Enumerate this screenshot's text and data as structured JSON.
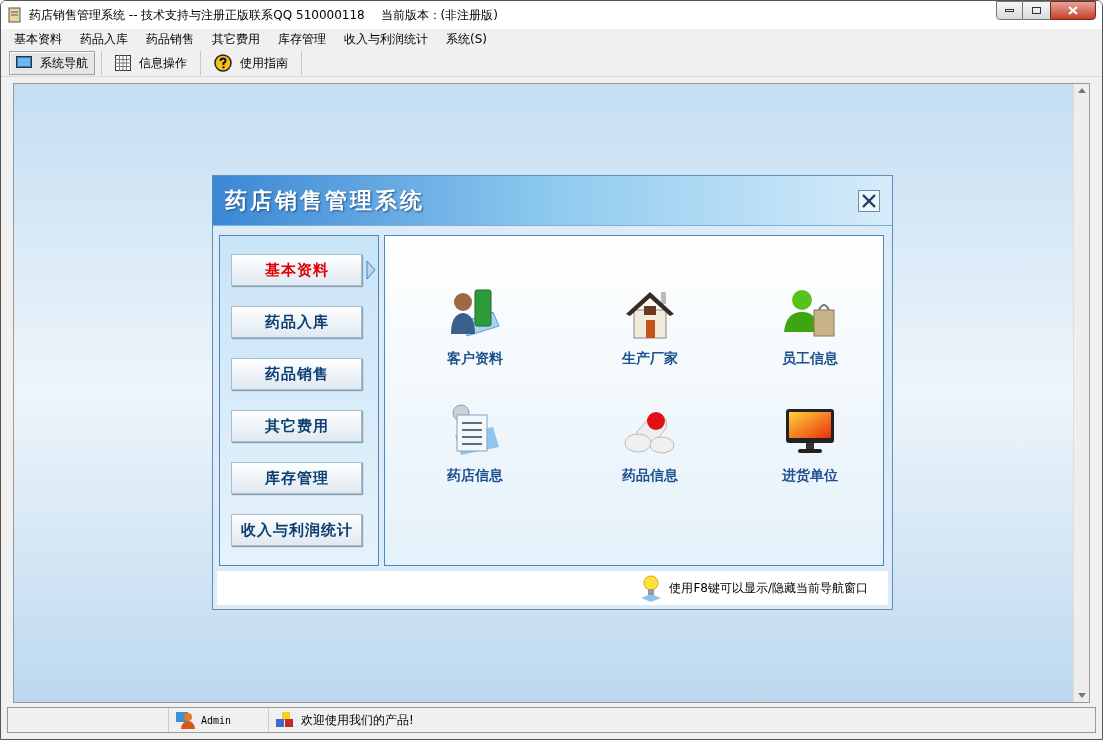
{
  "window": {
    "title": "药店销售管理系统 -- 技术支持与注册正版联系QQ 510000118　 当前版本：(非注册版)"
  },
  "menu": [
    "基本资料",
    "药品入库",
    "药品销售",
    "其它费用",
    "库存管理",
    "收入与利润统计",
    "系统(S)"
  ],
  "toolbar": [
    {
      "label": "系统导航",
      "kind": "monitor",
      "selected": true
    },
    {
      "label": "信息操作",
      "kind": "grid",
      "selected": false
    },
    {
      "label": "使用指南",
      "kind": "help",
      "selected": false
    }
  ],
  "dialog": {
    "title": "药店销售管理系统",
    "nav": [
      {
        "label": "基本资料",
        "selected": true
      },
      {
        "label": "药品入库",
        "selected": false
      },
      {
        "label": "药品销售",
        "selected": false
      },
      {
        "label": "其它费用",
        "selected": false
      },
      {
        "label": "库存管理",
        "selected": false
      },
      {
        "label": "收入与利润统计",
        "selected": false
      }
    ],
    "tiles": [
      {
        "label": "客户资料",
        "kind": "person"
      },
      {
        "label": "生产厂家",
        "kind": "house"
      },
      {
        "label": "员工信息",
        "kind": "shopper"
      },
      {
        "label": "药店信息",
        "kind": "papers"
      },
      {
        "label": "药品信息",
        "kind": "pills"
      },
      {
        "label": "进货单位",
        "kind": "monitor"
      }
    ],
    "hint": "使用F8键可以显示/隐藏当前导航窗口"
  },
  "status_bar": [
    {
      "text": "Admin",
      "kind": "user"
    },
    {
      "text": "欢迎使用我们的产品!",
      "kind": "cubes"
    }
  ]
}
